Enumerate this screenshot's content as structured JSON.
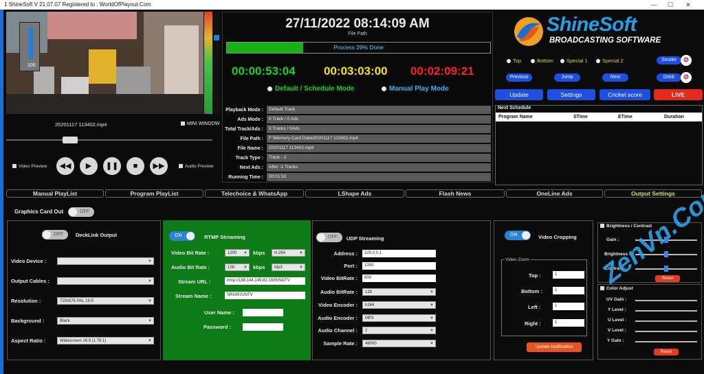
{
  "window": {
    "title": "1 ShineSoft V 21.07.07 Registered to : WorldOfPlayout.Com",
    "minimize": "—",
    "maximize": "☐",
    "close": "✕"
  },
  "preview": {
    "volume": "100",
    "filename": "20201117 113402.mp4",
    "mini_window": "MINI WINDOW",
    "video_preview": "Video Preview",
    "audio_preview": "Audio Preview"
  },
  "transport": {
    "rewind": "◀◀",
    "play": "▶",
    "pause": "❚❚",
    "stop": "■",
    "forward": "▶▶"
  },
  "center": {
    "datetime": "27/11/2022 08:14:09 AM",
    "file_path_label": "File Path",
    "progress_text": "Process 29% Done",
    "progress_fraction": 0.29,
    "timer_elapsed": "00:00:53:04",
    "timer_total": "00:03:03:00",
    "timer_remaining": "00:02:09:21",
    "mode_default": "Default / Schedule Mode",
    "mode_manual": "Manual Play Mode",
    "info": [
      {
        "label": "Playback Mode :",
        "value": "Default Track"
      },
      {
        "label": "Ads Mode :",
        "value": "0 Track / 0 Ads"
      },
      {
        "label": "Total Track/Ads :",
        "value": "3 Tracks / 0Ads"
      },
      {
        "label": "File Path :",
        "value": "F:\\Memory Card Data\\20201117 113402.mp4"
      },
      {
        "label": "File Name :",
        "value": "20201117 113402.mp4"
      },
      {
        "label": "Track Type :",
        "value": "Track - 2"
      },
      {
        "label": "Next Ads :",
        "value": "After -1 Tracks"
      },
      {
        "label": "Running Time :",
        "value": "00:01:50"
      }
    ]
  },
  "brand": {
    "name": "ShineSoft",
    "sub": "BROADCASTING SOFTWARE"
  },
  "positions": {
    "top": "Top",
    "bottom": "Bottom",
    "special1": "Special 1",
    "special2": "Special 2"
  },
  "buttons": {
    "smoke": "Smoke",
    "drink": "Drink",
    "previous": "Previous",
    "jump": "Jump",
    "next": "Next",
    "update": "Update",
    "settings": "Settings",
    "cricket": "Cricket score",
    "live": "LIVE"
  },
  "schedule": {
    "title": "Next Schedule",
    "columns": [
      "Program Name",
      "STime",
      "ETime",
      "Duration"
    ]
  },
  "tabs": [
    "Manual PlayList",
    "Program PlayList",
    "Telechoice & WhatsApp",
    "LShape Ads",
    "Flash News",
    "OneLine Ads",
    "Output Settings"
  ],
  "graphics": {
    "label": "Graphics Card Out",
    "toggle": "OFF"
  },
  "decklink": {
    "toggle": "OFF",
    "title": "DeckLink Output",
    "rows": [
      {
        "label": "Video Device :",
        "value": ""
      },
      {
        "label": "Output Cables :",
        "value": ""
      },
      {
        "label": "Resolution :",
        "value": "720x576 PAL 16:9"
      },
      {
        "label": "Background :",
        "value": "Black"
      },
      {
        "label": "Aspect Ratio :",
        "value": "Widescreen 16:9 (1.78:1)"
      }
    ]
  },
  "rtmp": {
    "toggle": "ON",
    "title": "RTMP Streaming",
    "video_bitrate_label": "Video Bit Rate :",
    "video_bitrate": "1200",
    "video_codec": "H.264",
    "audio_bitrate_label": "Audio Bit Rate :",
    "audio_bitrate": "128",
    "audio_codec": "Mp3",
    "kbps": "kbps",
    "url_label": "Stream URL :",
    "url": "rtmp://198.144.149.82:1935/NDTV",
    "name_label": "Stream Name :",
    "name": "SRIARJUNTV",
    "user_label": "User Name :",
    "password_label": "Password :"
  },
  "udp": {
    "toggle": "OFF",
    "title": "UDP Streaming",
    "rows": [
      {
        "label": "Address :",
        "value": "225.0.0.1"
      },
      {
        "label": "Port :",
        "value": "1000"
      },
      {
        "label": "Video BitRate :",
        "value": "800"
      },
      {
        "label": "Audio BitRate :",
        "value": "128"
      },
      {
        "label": "Video Encoder :",
        "value": "h264"
      },
      {
        "label": "Audio Encoder :",
        "value": "MP3"
      },
      {
        "label": "Audio Channel :",
        "value": "2"
      },
      {
        "label": "Sample Rate :",
        "value": "48000"
      }
    ]
  },
  "crop": {
    "toggle": "ON",
    "title": "Video Cropping",
    "zoom_title": "Video Zoom",
    "top_label": "Top :",
    "bottom_label": "Bottom :",
    "left_label": "Left :",
    "right_label": "Right :",
    "top": "1",
    "bottom": "1",
    "left": "1",
    "right": "1",
    "update": "Update Notification"
  },
  "bc": {
    "title": "Brightness / Contrast",
    "gain": "Gain :",
    "brightness": "Brightness :",
    "contrast": "Contrast :",
    "reset": "Reset"
  },
  "color": {
    "title": "Color Adjust",
    "uv_gain": "UV Gain :",
    "y_level": "Y Level :",
    "u_level": "U Level :",
    "v_level": "V Level :",
    "y_gain": "Y Gain :",
    "reset": "Reset"
  },
  "watermark": "ZenVn.Com"
}
